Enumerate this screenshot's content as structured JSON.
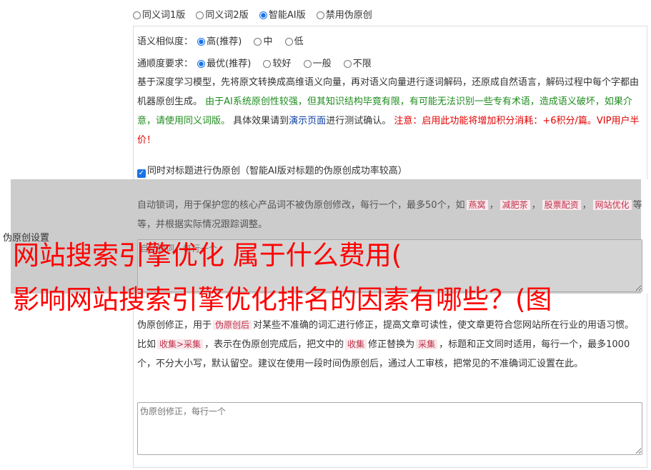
{
  "modes": [
    {
      "label": "同义词1版",
      "selected": false
    },
    {
      "label": "同义词2版",
      "selected": false
    },
    {
      "label": "智能AI版",
      "selected": true
    },
    {
      "label": "禁用伪原创",
      "selected": false
    }
  ],
  "similarity": {
    "label": "语义相似度：",
    "options": [
      {
        "label": "高(推荐)",
        "selected": true
      },
      {
        "label": "中",
        "selected": false
      },
      {
        "label": "低",
        "selected": false
      }
    ]
  },
  "fluency": {
    "label": "通顺度要求：",
    "options": [
      {
        "label": "最优(推荐)",
        "selected": true
      },
      {
        "label": "较好",
        "selected": false
      },
      {
        "label": "一般",
        "selected": false
      },
      {
        "label": "不限",
        "selected": false
      }
    ]
  },
  "description": {
    "part1": "基于深度学习模型，先将原文转换成高维语义向量，再对语义向量进行逐词解码，还原成自然语言，解码过程中每个字都由机器原创生成。",
    "green": "由于AI系统原创性较强，但其知识结构毕竟有限，有可能无法识别一些专有术语，造成语义破坏，如果介意，请使用同义词版。",
    "part2": "具体效果请到",
    "link": "演示页面",
    "part3": "进行测试确认。",
    "red": "注意：启用此功能将增加积分消耗：+6积分/篇。VIP用户半价！"
  },
  "title_checkbox": {
    "label": "同时对标题进行伪原创（智能AI版对标题的伪原创成功率较高）",
    "checked": true
  },
  "lock_words": {
    "text1": "自动锁词，用于保护您的核心产品词不被伪原创修改，每行一个，最多50个，如",
    "examples": [
      "燕窝",
      "减肥茶",
      "股票配资",
      "网站优化"
    ],
    "text2": "等等，并根据实际情况跟踪调整。",
    "placeholder": "自动锁词，每行一个"
  },
  "side_label": "伪原创设置",
  "correction": {
    "text1": "伪原创修正，用于",
    "tag1": "伪原创后",
    "text2": "对某些不准确的词汇进行修正，提高文章可读性，使文章更符合您网站所在行业的用语习惯。比如",
    "tag2": "收集>采集",
    "text3": "，表示在伪原创完成后，把文中的",
    "tag3": "收集",
    "text4": "修正替换为",
    "tag4": "采集",
    "text5": "，标题和正文同时适用，每行一个，最多1000个，不分大小写，默认留空。建议在使用一段时间伪原创后，通过人工审核，把常见的不准确词汇设置在此。",
    "placeholder": "伪原创修正，每行一个"
  },
  "overlay": {
    "line1": "网站搜索引擎优化 属于什么费用(",
    "line2": "影响网站搜索引擎优化排名的因素有哪些？(图"
  }
}
